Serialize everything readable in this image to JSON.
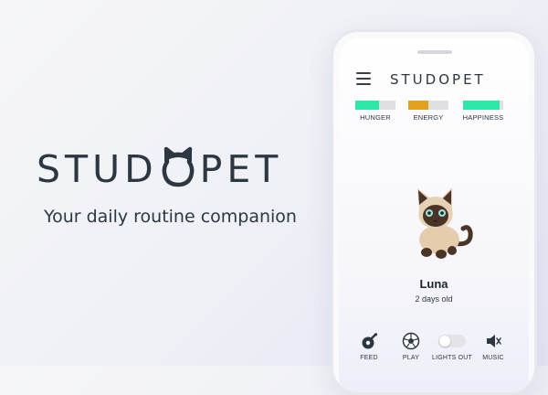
{
  "hero": {
    "logo_text_left": "STUD",
    "logo_text_right": "PET",
    "tagline": "Your daily routine companion"
  },
  "app": {
    "title": "STUDOPET",
    "stats": [
      {
        "label": "HUNGER",
        "level": 0.6,
        "color": "#2de8a6"
      },
      {
        "label": "ENERGY",
        "level": 0.5,
        "color": "#e0a020"
      },
      {
        "label": "HAPPINESS",
        "level": 0.9,
        "color": "#2de8a6"
      }
    ],
    "pet": {
      "name": "Luna",
      "age": "2 days old"
    },
    "actions": [
      {
        "label": "FEED",
        "icon": "meat-icon"
      },
      {
        "label": "PLAY",
        "icon": "soccer-ball-icon"
      },
      {
        "label": "LIGHTS OUT",
        "icon": "toggle-switch",
        "state": "off"
      },
      {
        "label": "MUSIC",
        "icon": "speaker-muted-icon"
      }
    ]
  },
  "colors": {
    "text_dark": "#2d3741",
    "bar_empty": "#e0e0e4"
  }
}
